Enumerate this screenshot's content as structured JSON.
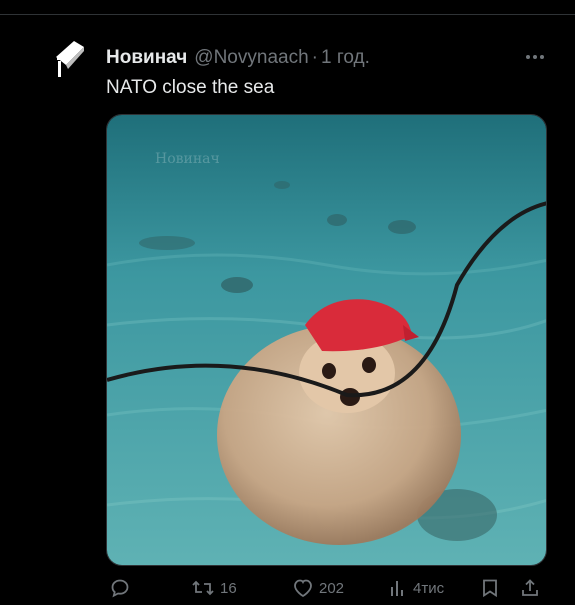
{
  "tweet": {
    "author_name": "Новинач",
    "handle": "@Novynaach",
    "separator": "·",
    "time": "1 год.",
    "text": "NATO close the sea",
    "media": {
      "watermark": "Новинач"
    }
  },
  "actions": {
    "reply": {
      "icon": "reply-icon"
    },
    "retweet": {
      "icon": "retweet-icon",
      "count": "16"
    },
    "like": {
      "icon": "heart-icon",
      "count": "202"
    },
    "views": {
      "icon": "views-icon",
      "count": "4тис"
    },
    "bookmark": {
      "icon": "bookmark-icon"
    },
    "share": {
      "icon": "share-icon"
    }
  },
  "colors": {
    "background": "#000000",
    "text_primary": "#e7e9ea",
    "text_secondary": "#71767b",
    "border": "#2f3336",
    "water": "#3f9aa1"
  }
}
